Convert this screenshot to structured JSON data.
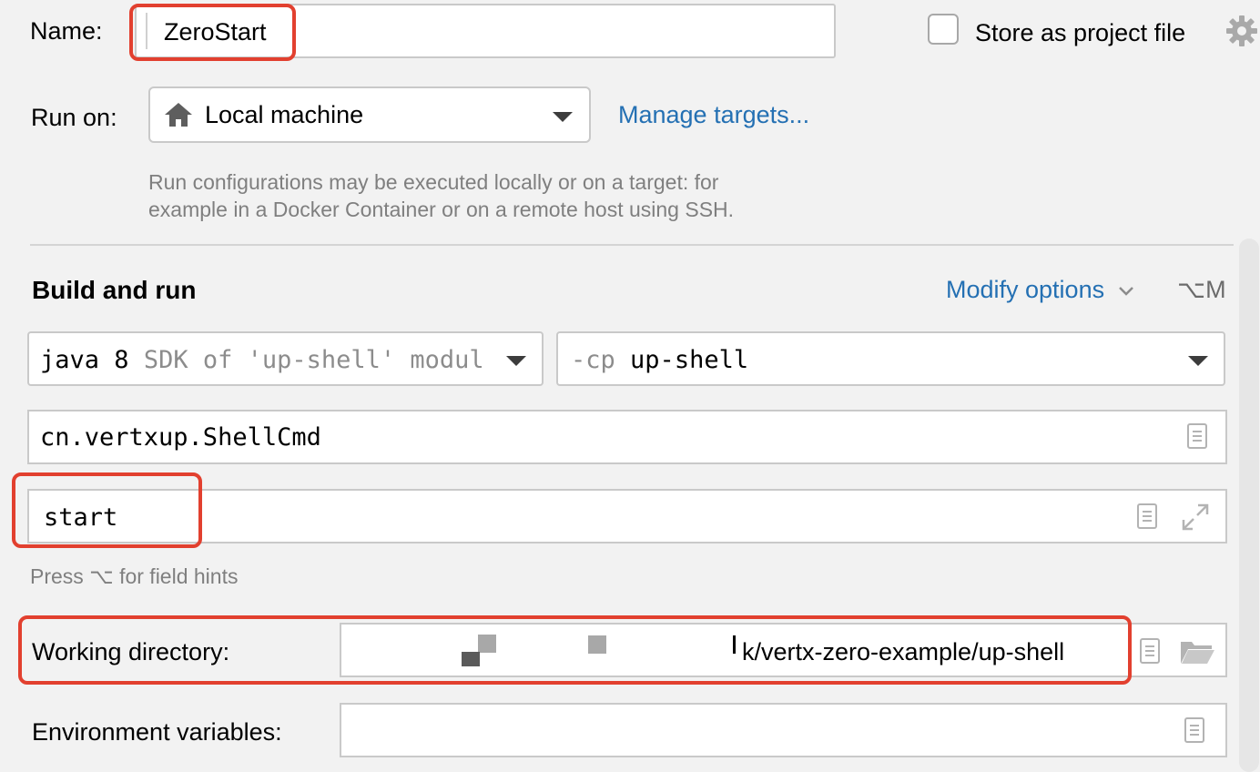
{
  "name": {
    "label": "Name:",
    "value": "ZeroStart"
  },
  "store": {
    "label": "Store as project file",
    "checked": false
  },
  "run_on": {
    "label": "Run on:",
    "value": "Local machine",
    "manage_link": "Manage targets...",
    "hint_line1": "Run configurations may be executed locally or on a target: for",
    "hint_line2": "example in a Docker Container or on a remote host using SSH."
  },
  "build": {
    "title": "Build and run",
    "modify_options": "Modify options",
    "shortcut": "⌥M",
    "jdk_main": "java 8",
    "jdk_hint": "SDK of 'up-shell' modul",
    "cp_prefix": "-cp",
    "cp_value": "up-shell",
    "main_class": "cn.vertxup.ShellCmd",
    "program_args": "start",
    "field_hint": "Press ⌥ for field hints"
  },
  "working_dir": {
    "label": "Working directory:",
    "value": "k/vertx-zero-example/up-shell"
  },
  "env_vars": {
    "label": "Environment variables:",
    "value": ""
  },
  "colors": {
    "accent": "#2470b3",
    "highlight": "#e2402f",
    "background": "#f2f2f2"
  }
}
